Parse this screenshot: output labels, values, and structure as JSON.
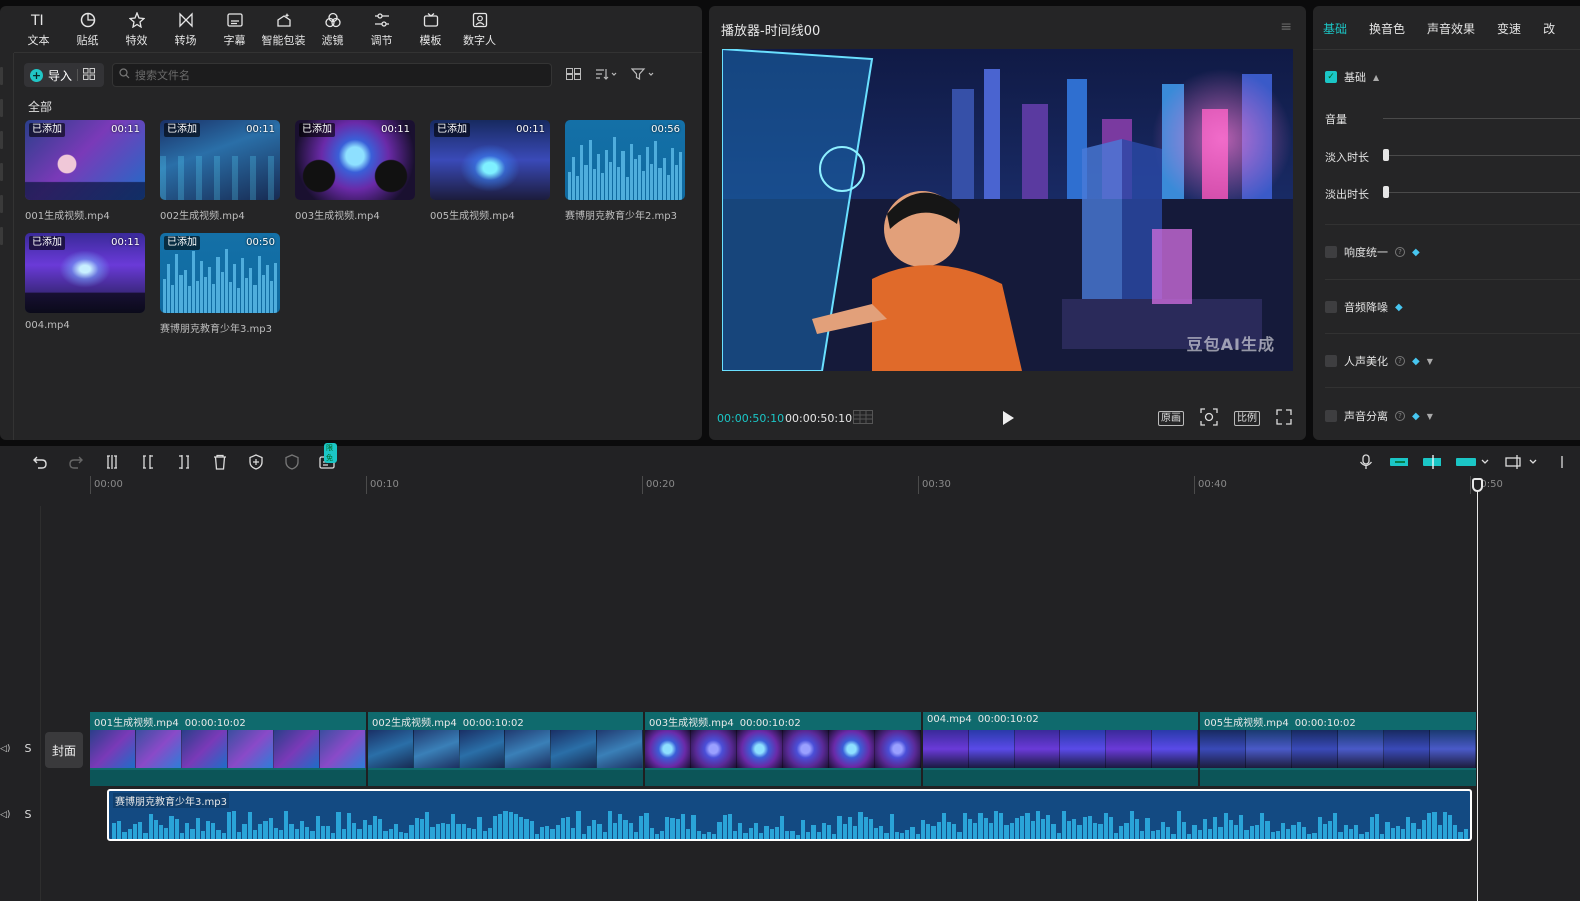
{
  "toolbar": {
    "items": [
      {
        "label": "文本",
        "icon": "text-icon"
      },
      {
        "label": "贴纸",
        "icon": "sticker-icon"
      },
      {
        "label": "特效",
        "icon": "effects-icon"
      },
      {
        "label": "转场",
        "icon": "transition-icon"
      },
      {
        "label": "字幕",
        "icon": "subtitle-icon"
      },
      {
        "label": "智能包装",
        "icon": "smart-package-icon"
      },
      {
        "label": "滤镜",
        "icon": "filter-icon"
      },
      {
        "label": "调节",
        "icon": "adjust-icon"
      },
      {
        "label": "模板",
        "icon": "template-icon"
      },
      {
        "label": "数字人",
        "icon": "digital-human-icon"
      }
    ]
  },
  "media": {
    "import_label": "导入",
    "search_placeholder": "搜索文件名",
    "section_label": "全部",
    "items": [
      {
        "name": "001生成视频.mp4",
        "duration": "00:11",
        "badge": "已添加",
        "type": "video"
      },
      {
        "name": "002生成视频.mp4",
        "duration": "00:11",
        "badge": "已添加",
        "type": "video"
      },
      {
        "name": "003生成视频.mp4",
        "duration": "00:11",
        "badge": "已添加",
        "type": "video"
      },
      {
        "name": "005生成视频.mp4",
        "duration": "00:11",
        "badge": "已添加",
        "type": "video"
      },
      {
        "name": "赛博朋克教育少年2.mp3",
        "duration": "00:56",
        "badge": "",
        "type": "audio"
      },
      {
        "name": "004.mp4",
        "duration": "00:11",
        "badge": "已添加",
        "type": "video"
      },
      {
        "name": "赛博朋克教育少年3.mp3",
        "duration": "00:50",
        "badge": "已添加",
        "type": "audio"
      }
    ]
  },
  "player": {
    "title": "播放器-时间线00",
    "current_time": "00:00:50:10",
    "total_time": "00:00:50:10",
    "watermark": "豆包AI生成",
    "buttons": [
      "原画",
      "比例"
    ]
  },
  "properties": {
    "tabs": [
      "基础",
      "换音色",
      "声音效果",
      "变速",
      "改"
    ],
    "active_tab": "基础",
    "section": "基础",
    "volume_label": "音量",
    "fade_in_label": "淡入时长",
    "fade_out_label": "淡出时长",
    "options": [
      {
        "label": "响度统一",
        "checked": false
      },
      {
        "label": "音频降噪",
        "checked": false
      },
      {
        "label": "人声美化",
        "checked": false
      },
      {
        "label": "声音分离",
        "checked": false
      }
    ]
  },
  "timeline": {
    "limit_badge": "限免",
    "ruler": [
      "00:00",
      "00:10",
      "00:20",
      "00:30",
      "00:40",
      "00:50"
    ],
    "cover_label": "封面",
    "track_solo": "S",
    "video_clips": [
      {
        "name": "001生成视频.mp4",
        "duration": "00:00:10:02"
      },
      {
        "name": "002生成视频.mp4",
        "duration": "00:00:10:02"
      },
      {
        "name": "003生成视频.mp4",
        "duration": "00:00:10:02"
      },
      {
        "name": "004.mp4",
        "duration": "00:00:10:02"
      },
      {
        "name": "005生成视频.mp4",
        "duration": "00:00:10:02"
      }
    ],
    "audio_clip": {
      "name": "赛博朋克教育少年3.mp3"
    }
  },
  "colors": {
    "accent": "#1bc6c6",
    "video_track": "#0f6a6d",
    "audio_track": "#134a82"
  }
}
